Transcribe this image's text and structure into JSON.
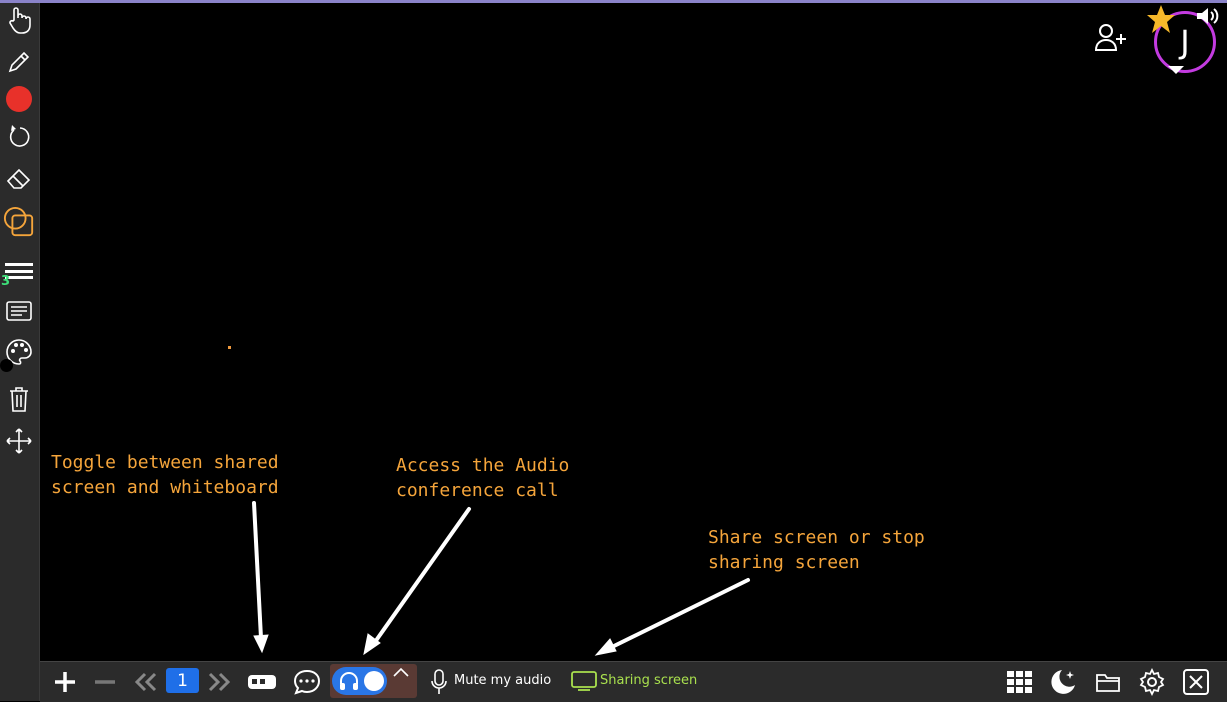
{
  "annotations": {
    "toggle": "Toggle between shared\nscreen and whiteboard",
    "audio": "Access the Audio\nconference call",
    "share": "Share screen or stop\nsharing screen"
  },
  "sidebar": {
    "line_width_value": "3",
    "pen_color": "#e8312a",
    "accent": "#f5a53b",
    "icons": [
      "pointer-hand-icon",
      "pencil-icon",
      "color-dot-icon",
      "undo-icon",
      "eraser-icon",
      "shapes-icon",
      "line-width-icon",
      "text-icon",
      "palette-icon",
      "trash-icon",
      "move-icon"
    ]
  },
  "toolbar": {
    "page_number": "1",
    "mute_label": "Mute my audio",
    "share_label": "Sharing screen",
    "accent_blue": "#1f6fe8",
    "share_color": "#a9e04e"
  },
  "header": {
    "avatar_initial": "J",
    "avatar_border": "#c33be0"
  }
}
